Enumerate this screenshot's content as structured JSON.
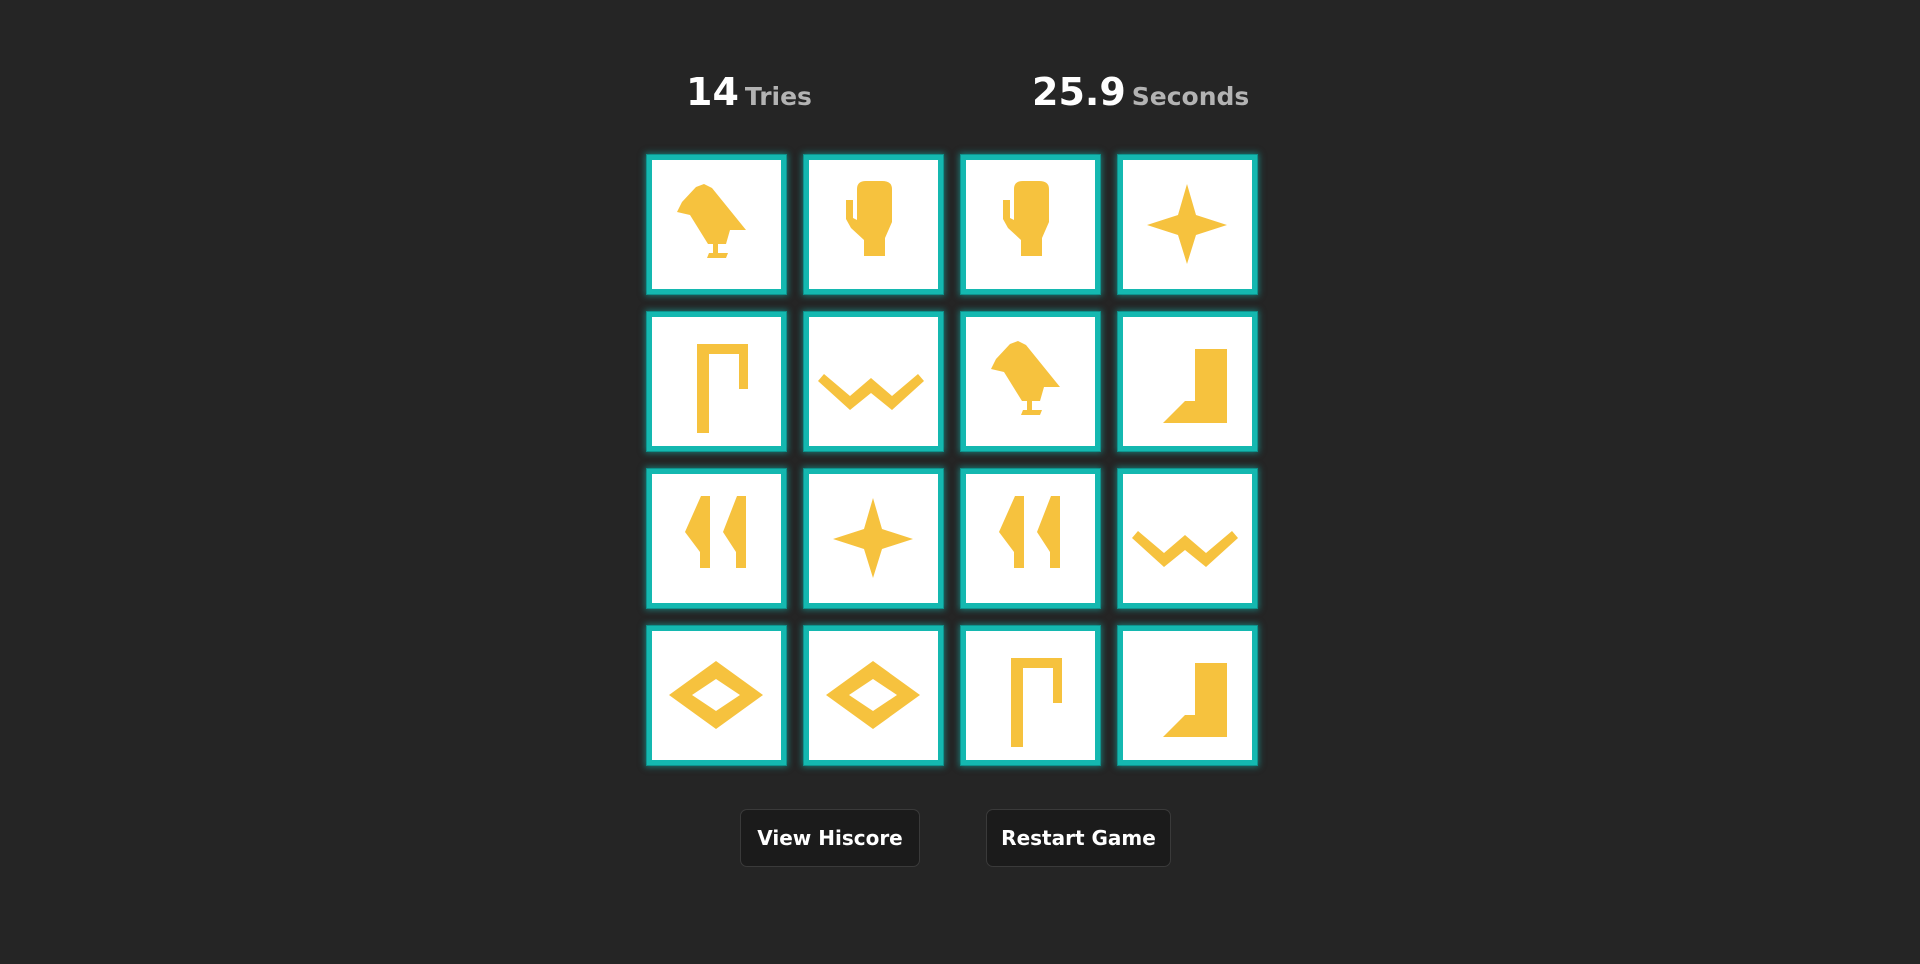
{
  "stats": {
    "tries_value": "14",
    "tries_label": "Tries",
    "seconds_value": "25.9",
    "seconds_label": "Seconds"
  },
  "board": {
    "rows": 4,
    "cols": 4,
    "tile_border_color": "#14b8b0",
    "symbol_color": "#f6c23e",
    "tiles": [
      "bird",
      "hand",
      "hand",
      "star",
      "staff",
      "zigzag",
      "bird",
      "boot",
      "reeds",
      "star",
      "reeds",
      "zigzag",
      "diamond",
      "diamond",
      "staff",
      "boot"
    ]
  },
  "buttons": {
    "hiscore_label": "View Hiscore",
    "restart_label": "Restart Game"
  }
}
